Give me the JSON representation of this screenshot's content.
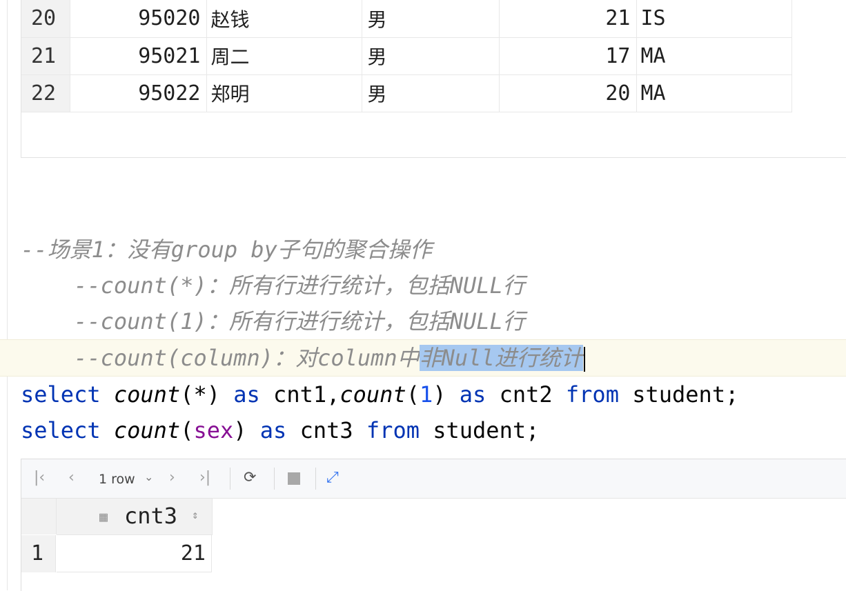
{
  "top_result": {
    "rows": [
      {
        "num": "20",
        "id": "95020",
        "name": "赵钱",
        "sex": "男",
        "age": "21",
        "dept": "IS"
      },
      {
        "num": "21",
        "id": "95021",
        "name": "周二",
        "sex": "男",
        "age": "17",
        "dept": "MA"
      },
      {
        "num": "22",
        "id": "95022",
        "name": "郑明",
        "sex": "男",
        "age": "20",
        "dept": "MA"
      }
    ]
  },
  "editor": {
    "comment1": "--场景1：没有group by子句的聚合操作",
    "comment2": "    --count(*)：所有行进行统计，包括NULL行",
    "comment3": "    --count(1)：所有行进行统计，包括NULL行",
    "comment4_before": "    --count(column)：对column中",
    "comment4_selected": "非Null进行统计",
    "sql1": {
      "select": "select",
      "fn1": "count",
      "arg1_open": "(",
      "arg1": "*",
      "arg1_close": ")",
      "as1": "as",
      "alias1": "cnt1,",
      "fn2": "count",
      "arg2_open": "(",
      "arg2": "1",
      "arg2_close": ")",
      "as2": "as",
      "alias2": "cnt2",
      "from": "from",
      "table": "student;"
    },
    "sql2": {
      "select": "select",
      "fn": "count",
      "open": "(",
      "arg": "sex",
      "close": ")",
      "as": "as",
      "alias": "cnt3",
      "from": "from",
      "table": "student;"
    }
  },
  "result_panel": {
    "toolbar": {
      "first_icon": "first-page-icon",
      "prev_icon": "previous-page-icon",
      "rows_label": "1 row",
      "next_icon": "next-page-icon",
      "last_icon": "last-page-icon",
      "refresh_icon": "refresh-icon",
      "stop_icon": "stop-icon",
      "pin_icon": "pin-icon"
    },
    "columns": [
      "cnt3"
    ],
    "rows": [
      {
        "num": "1",
        "values": [
          "21"
        ]
      }
    ]
  }
}
